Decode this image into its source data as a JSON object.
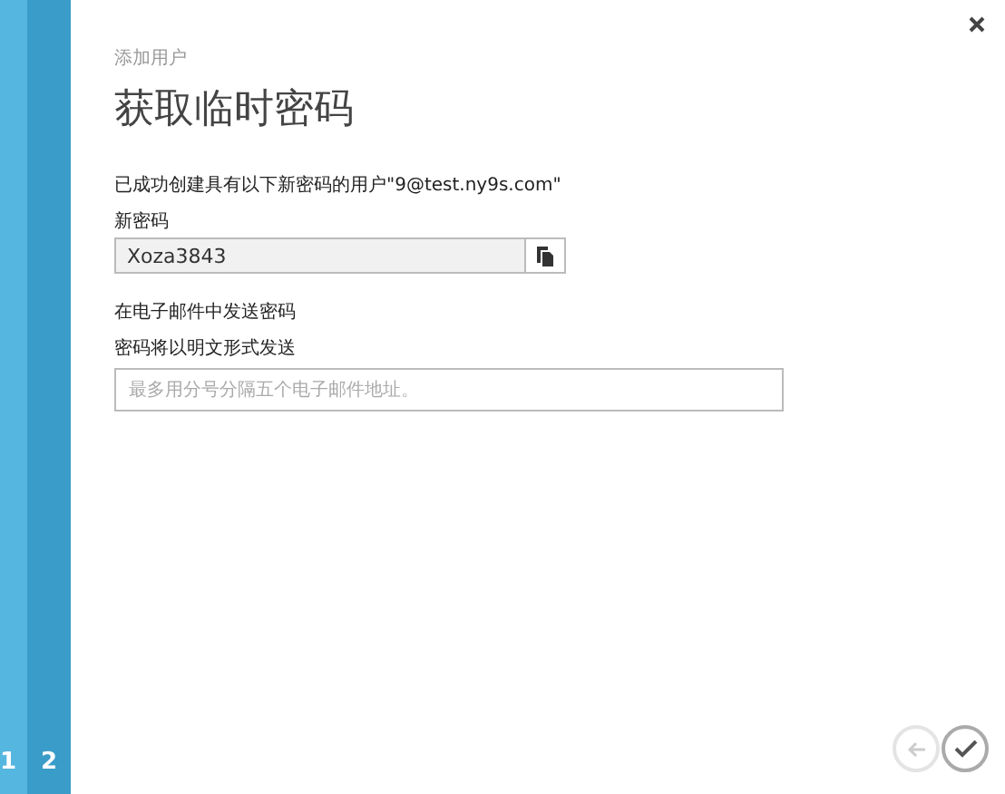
{
  "steps": [
    {
      "label": "1",
      "selected": false
    },
    {
      "label": "2",
      "selected": true
    }
  ],
  "breadcrumb": "添加用户",
  "title": "获取临时密码",
  "message": "已成功创建具有以下新密码的用户\"9@test.ny9s.com\"",
  "password": {
    "label": "新密码",
    "value": "Xoza3843"
  },
  "email": {
    "label": "在电子邮件中发送密码",
    "note": "密码将以明文形式发送",
    "placeholder": "最多用分号分隔五个电子邮件地址。"
  },
  "back_button": {
    "disabled": true
  }
}
